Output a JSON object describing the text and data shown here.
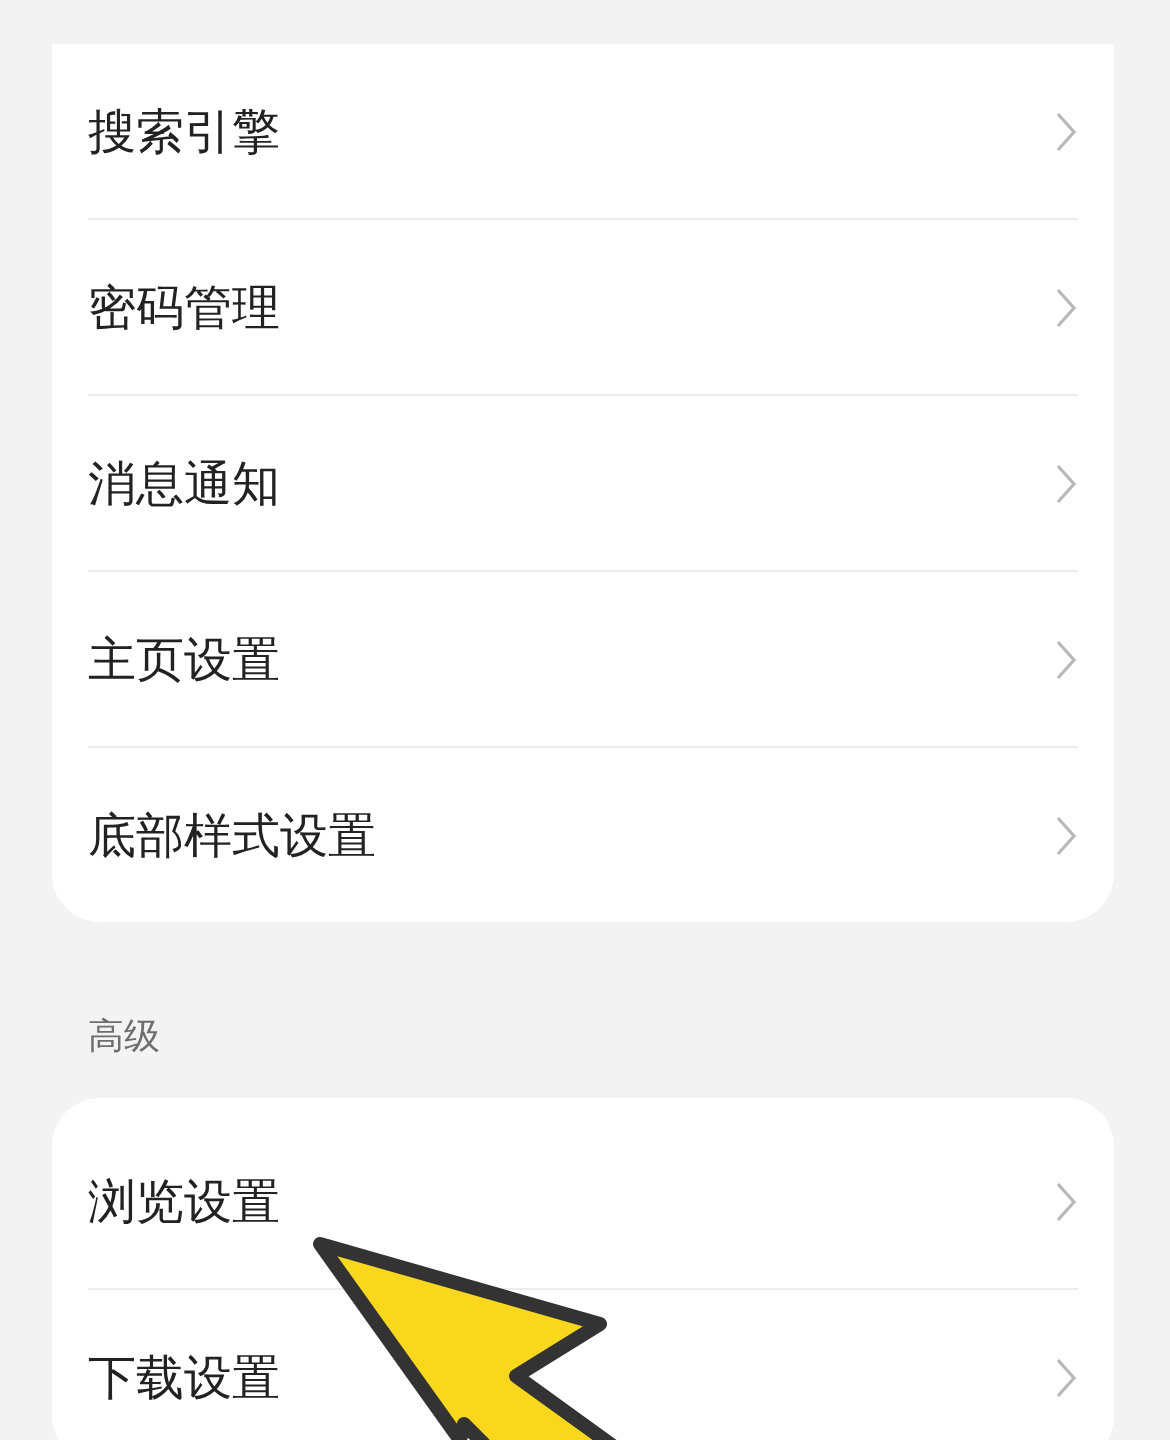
{
  "groups": [
    {
      "items": [
        {
          "label": "搜索引擎"
        },
        {
          "label": "密码管理"
        },
        {
          "label": "消息通知"
        },
        {
          "label": "主页设置"
        },
        {
          "label": "底部样式设置"
        }
      ]
    },
    {
      "header": "高级",
      "items": [
        {
          "label": "浏览设置"
        },
        {
          "label": "下载设置"
        }
      ]
    }
  ]
}
